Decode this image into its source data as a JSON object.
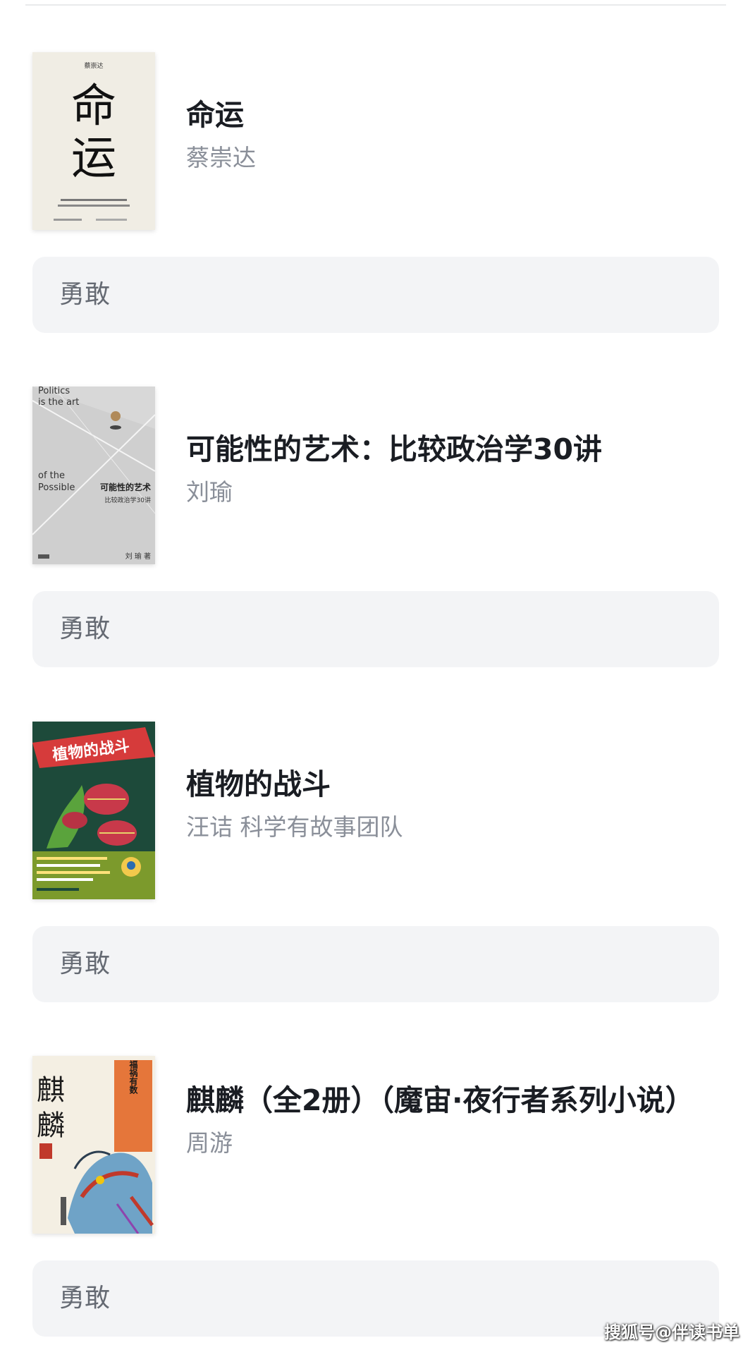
{
  "books": [
    {
      "title": "命运",
      "author": "蔡崇达",
      "tag": "勇敢",
      "cover": {
        "icon": "book-cover-mingyun",
        "author_small": "蔡崇达",
        "title_line1": "命",
        "title_line2": "运"
      }
    },
    {
      "title": "可能性的艺术：比较政治学30讲",
      "author": "刘瑜",
      "tag": "勇敢",
      "cover": {
        "icon": "book-cover-politics",
        "en_line1": "Politics",
        "en_line2": "is the art",
        "en_line3": "of the",
        "en_line4": "Possible",
        "cn_title": "可能性的艺术",
        "cn_subtitle": "比较政治学30讲",
        "cn_author": "刘 瑜  著"
      }
    },
    {
      "title": "植物的战斗",
      "author": "汪诘 科学有故事团队",
      "tag": "勇敢",
      "cover": {
        "icon": "book-cover-plants",
        "banner": "植物的战斗"
      }
    },
    {
      "title": "麒麟（全2册）（魔宙·夜行者系列小说）",
      "author": "周游",
      "tag": "勇敢",
      "cover": {
        "icon": "book-cover-qilin",
        "calligraphy1": "麒",
        "calligraphy2": "麟",
        "vertical_text": "福祸有数"
      }
    }
  ],
  "watermark": "搜狐号@伴读书单",
  "colors": {
    "tag_bg": "#f3f4f6",
    "title": "#1a1d23",
    "author": "#8a8f99"
  }
}
